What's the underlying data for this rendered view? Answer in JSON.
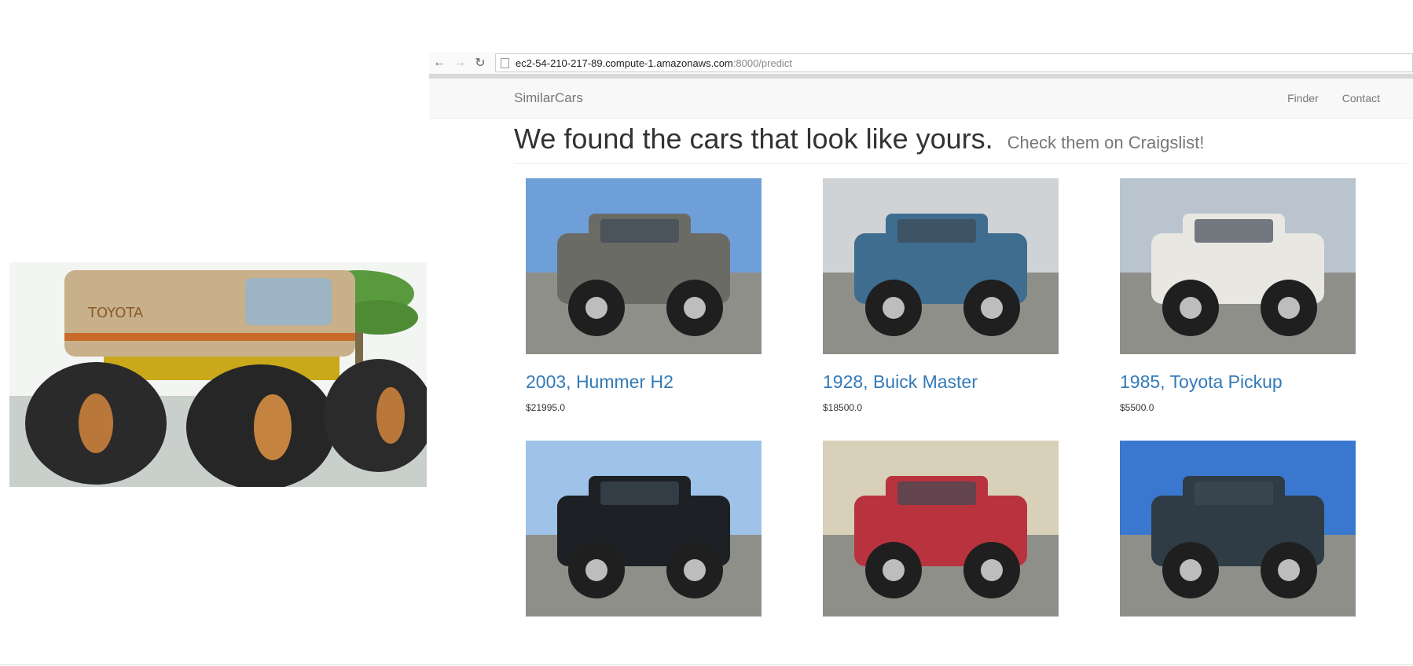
{
  "browser": {
    "url_host": "ec2-54-210-217-89.compute-1.amazonaws.com",
    "url_path": ":8000/predict"
  },
  "navbar": {
    "brand": "SimilarCars",
    "links": [
      "Finder",
      "Contact"
    ]
  },
  "main": {
    "headline": "We found the cars that look like yours.",
    "subheadline": "Check them on Craigslist!"
  },
  "query_image": {
    "decal_text": "TOYOTA"
  },
  "results": [
    {
      "title": "2003, Hummer H2",
      "price": "$21995.0",
      "color": "#6b6b66",
      "sky": "#6f9fd8"
    },
    {
      "title": "1928, Buick Master",
      "price": "$18500.0",
      "color": "#3f6d8f",
      "sky": "#cfd3d6"
    },
    {
      "title": "1985, Toyota Pickup",
      "price": "$5500.0",
      "color": "#e9e7e2",
      "sky": "#b9c4cf"
    },
    {
      "title": "",
      "price": "",
      "color": "#1d2024",
      "sky": "#9fc2e8"
    },
    {
      "title": "",
      "price": "",
      "color": "#b8333e",
      "sky": "#d8d0b8"
    },
    {
      "title": "",
      "price": "",
      "color": "#2f3c45",
      "sky": "#3a78d0"
    }
  ]
}
